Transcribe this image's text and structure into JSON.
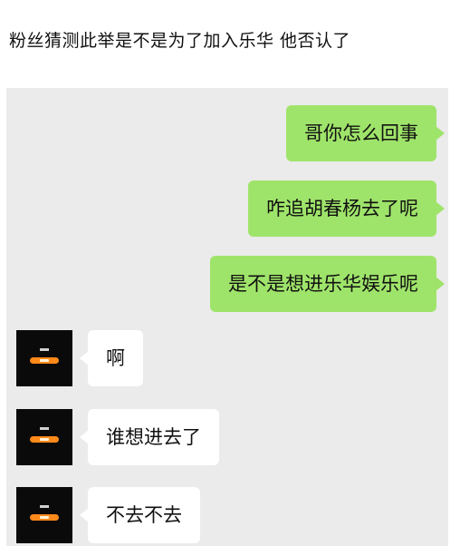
{
  "caption": "粉丝猜测此举是不是为了加入乐华 他否认了",
  "messages": [
    {
      "side": "sent",
      "text": "哥你怎么回事"
    },
    {
      "side": "sent",
      "text": "咋追胡春杨去了呢"
    },
    {
      "side": "sent",
      "text": "是不是想进乐华娱乐呢"
    },
    {
      "side": "recv",
      "text": "啊"
    },
    {
      "side": "recv",
      "text": "谁想进去了"
    },
    {
      "side": "recv",
      "text": "不去不去"
    }
  ],
  "colors": {
    "chat_background": "#ebebeb",
    "sent_bubble": "#9fe46a",
    "received_bubble": "#ffffff",
    "avatar_background": "#0a0a0a",
    "avatar_accent": "#ff8a1a"
  }
}
